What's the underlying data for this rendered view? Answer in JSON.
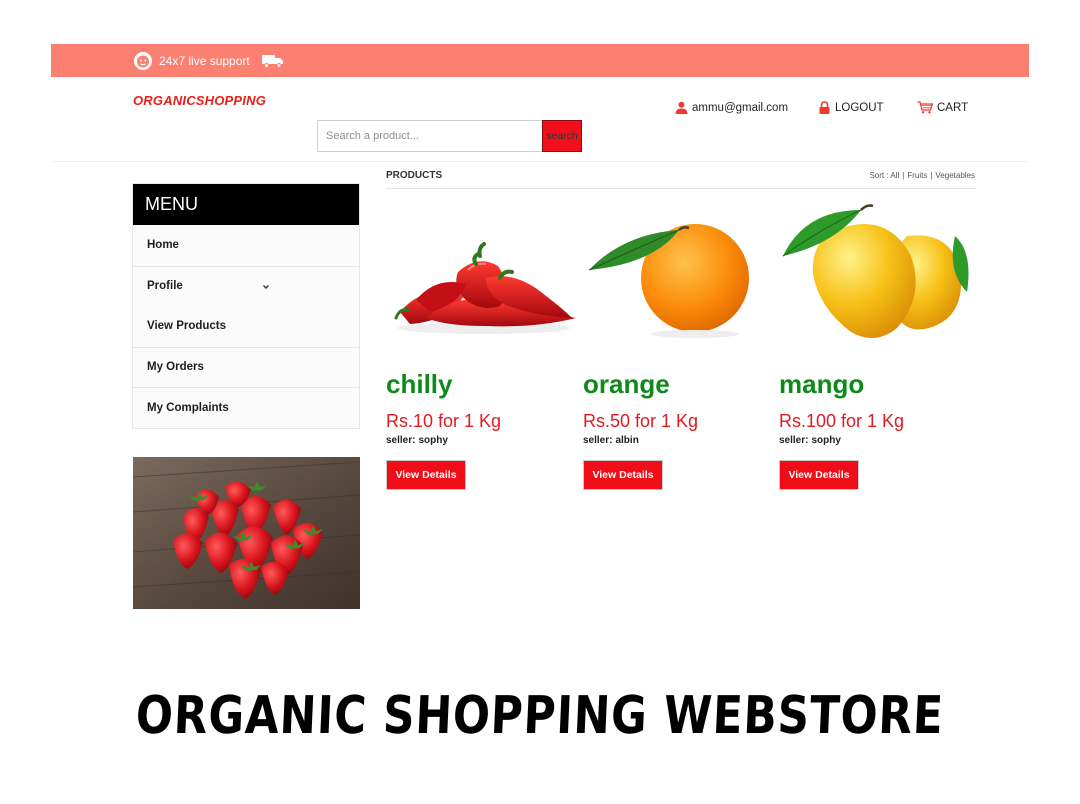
{
  "topbar": {
    "support_text": "24x7 live support"
  },
  "header": {
    "brand": "ORGANICSHOPPING",
    "search_placeholder": "Search a product...",
    "search_label": "search",
    "user_email": "ammu@gmail.com",
    "logout_label": "LOGOUT",
    "cart_label": "CART"
  },
  "menu": {
    "title": "MENU",
    "items": [
      {
        "label": "Home"
      },
      {
        "label": "Profile"
      },
      {
        "label": "View Products"
      },
      {
        "label": "My Orders"
      },
      {
        "label": "My Complaints"
      }
    ]
  },
  "products": {
    "title": "PRODUCTS",
    "sort_prefix": "Sort : All",
    "sort_sep": "|",
    "sort_fruits": "Fruits",
    "sort_vegetables": "Vegetables",
    "items": [
      {
        "name": "chilly",
        "price": "Rs.10 for 1 Kg",
        "seller_label": "seller:",
        "seller": "sophy",
        "button": "View Details"
      },
      {
        "name": "orange",
        "price": "Rs.50 for 1 Kg",
        "seller_label": "seller:",
        "seller": "albin",
        "button": "View Details"
      },
      {
        "name": "mango",
        "price": "Rs.100 for 1 Kg",
        "seller_label": "seller:",
        "seller": "sophy",
        "button": "View Details"
      }
    ]
  },
  "banner": {
    "text": "ORGANIC SHOPPING WEBSTORE"
  },
  "colors": {
    "topbar": "#fb8072",
    "brand": "#e8201a",
    "accent_red": "#f00d18",
    "product_name": "#0d8a1a"
  }
}
